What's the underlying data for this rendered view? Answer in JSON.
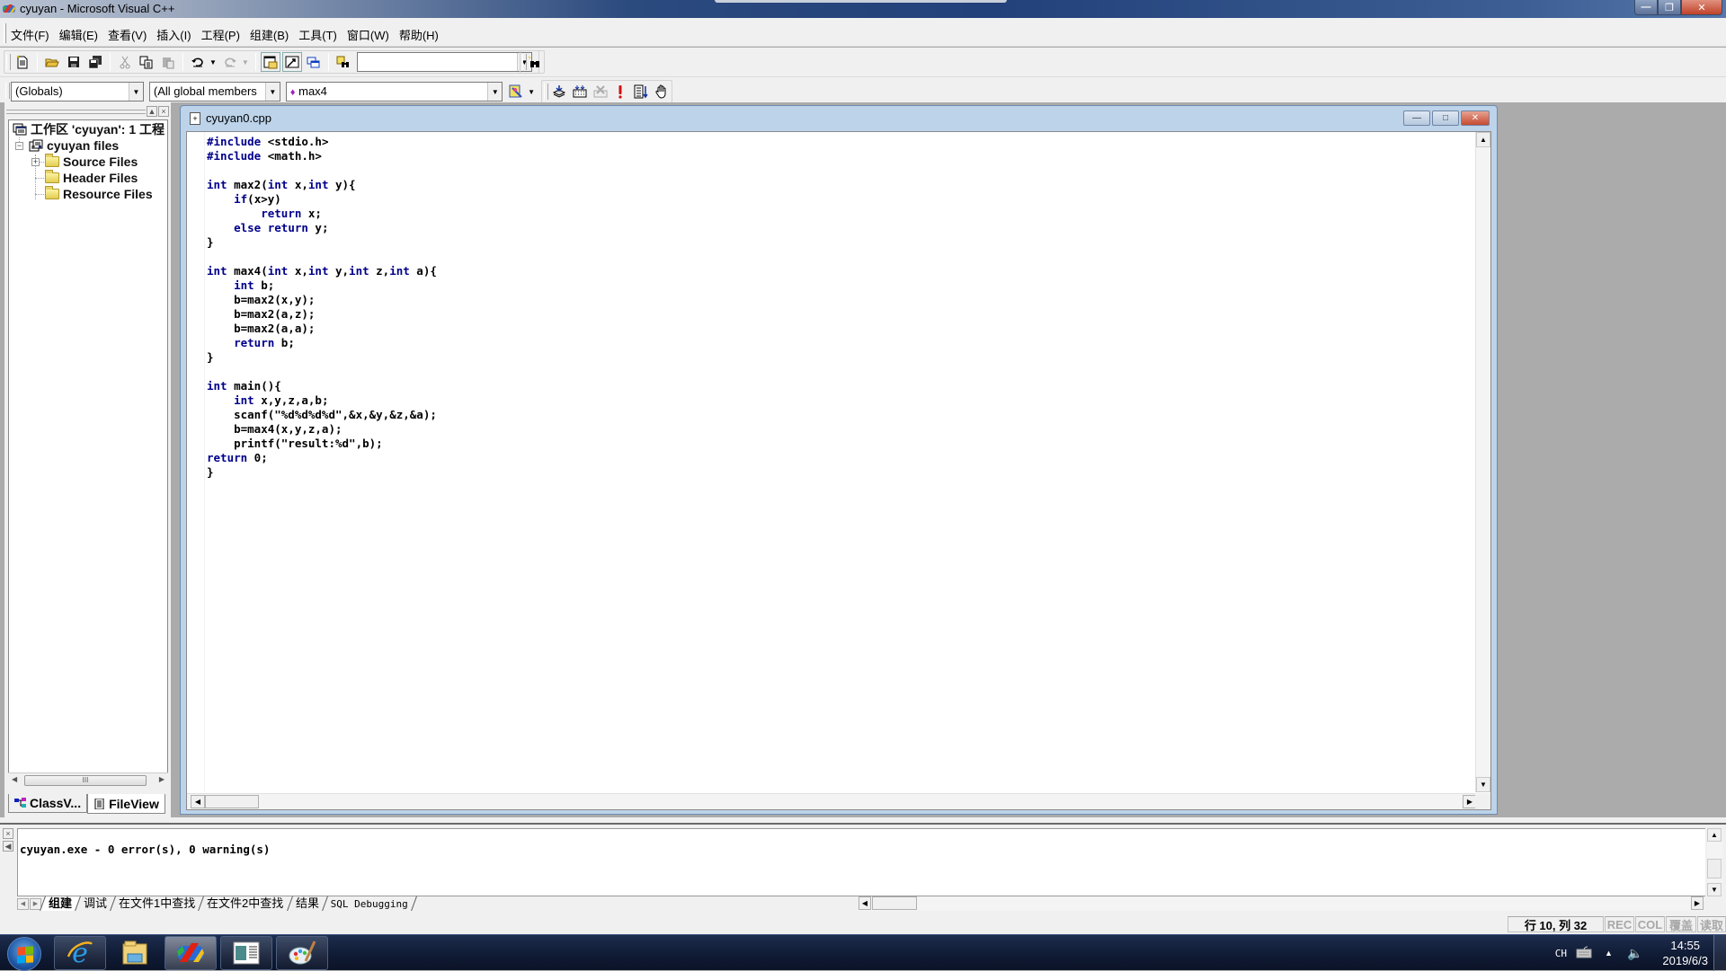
{
  "window": {
    "title": "cyuyan - Microsoft Visual C++",
    "buttons": {
      "minimize": "minimize",
      "maximize": "maximize",
      "close": "close"
    }
  },
  "menu": {
    "items": [
      {
        "label": "文件(F)"
      },
      {
        "label": "编辑(E)"
      },
      {
        "label": "查看(V)"
      },
      {
        "label": "插入(I)"
      },
      {
        "label": "工程(P)"
      },
      {
        "label": "组建(B)"
      },
      {
        "label": "工具(T)"
      },
      {
        "label": "窗口(W)"
      },
      {
        "label": "帮助(H)"
      }
    ]
  },
  "toolbar": {
    "standard_icons": [
      "new-text-file-icon",
      "open-icon",
      "save-icon",
      "save-all-icon",
      "cut-icon",
      "copy-icon",
      "paste-icon",
      "undo-icon",
      "redo-icon",
      "workspace-icon",
      "output-icon",
      "window-list-icon",
      "find-in-files-icon"
    ],
    "find_combo_value": "",
    "find_icon": "find-icon"
  },
  "wizardbar": {
    "scope": "(Globals)",
    "filter": "(All global members",
    "member": "max4",
    "member_color": "#a020c0",
    "build_icons": [
      "compile-icon",
      "build-icon",
      "stop-build-icon",
      "execute-icon",
      "go-icon",
      "breakpoint-icon"
    ]
  },
  "workspace": {
    "tree": {
      "root": "工作区 'cyuyan': 1 工程",
      "project": "cyuyan files",
      "folders": [
        "Source Files",
        "Header Files",
        "Resource Files"
      ]
    },
    "tabs": [
      {
        "label": "ClassV...",
        "active": false
      },
      {
        "label": "FileView",
        "active": true
      }
    ]
  },
  "editor": {
    "filename": "cyuyan0.cpp",
    "code_lines": [
      [
        [
          "kw",
          "#include"
        ],
        [
          "t",
          " <stdio.h>"
        ]
      ],
      [
        [
          "kw",
          "#include"
        ],
        [
          "t",
          " <math.h>"
        ]
      ],
      [],
      [
        [
          "kw",
          "int"
        ],
        [
          "t",
          " max2("
        ],
        [
          "kw",
          "int"
        ],
        [
          "t",
          " x,"
        ],
        [
          "kw",
          "int"
        ],
        [
          "t",
          " y){"
        ]
      ],
      [
        [
          "t",
          "    "
        ],
        [
          "kw",
          "if"
        ],
        [
          "t",
          "(x>y)"
        ]
      ],
      [
        [
          "t",
          "        "
        ],
        [
          "kw",
          "return"
        ],
        [
          "t",
          " x;"
        ]
      ],
      [
        [
          "t",
          "    "
        ],
        [
          "kw",
          "else"
        ],
        [
          "t",
          " "
        ],
        [
          "kw",
          "return"
        ],
        [
          "t",
          " y;"
        ]
      ],
      [
        [
          "t",
          "}"
        ]
      ],
      [],
      [
        [
          "kw",
          "int"
        ],
        [
          "t",
          " max4("
        ],
        [
          "kw",
          "int"
        ],
        [
          "t",
          " x,"
        ],
        [
          "kw",
          "int"
        ],
        [
          "t",
          " y,"
        ],
        [
          "kw",
          "int"
        ],
        [
          "t",
          " z,"
        ],
        [
          "kw",
          "int"
        ],
        [
          "t",
          " a){"
        ]
      ],
      [
        [
          "t",
          "    "
        ],
        [
          "kw",
          "int"
        ],
        [
          "t",
          " b;"
        ]
      ],
      [
        [
          "t",
          "    b=max2(x,y);"
        ]
      ],
      [
        [
          "t",
          "    b=max2(a,z);"
        ]
      ],
      [
        [
          "t",
          "    b=max2(a,a);"
        ]
      ],
      [
        [
          "t",
          "    "
        ],
        [
          "kw",
          "return"
        ],
        [
          "t",
          " b;"
        ]
      ],
      [
        [
          "t",
          "}"
        ]
      ],
      [],
      [
        [
          "kw",
          "int"
        ],
        [
          "t",
          " main(){"
        ]
      ],
      [
        [
          "t",
          "    "
        ],
        [
          "kw",
          "int"
        ],
        [
          "t",
          " x,y,z,a,b;"
        ]
      ],
      [
        [
          "t",
          "    scanf(\"%d%d%d%d\",&x,&y,&z,&a);"
        ]
      ],
      [
        [
          "t",
          "    b=max4(x,y,z,a);"
        ]
      ],
      [
        [
          "t",
          "    printf(\"result:%d\",b);"
        ]
      ],
      [
        [
          "kw",
          "return"
        ],
        [
          "t",
          " 0;"
        ]
      ],
      [
        [
          "t",
          "}"
        ]
      ]
    ]
  },
  "output": {
    "text": "cyuyan.exe - 0 error(s), 0 warning(s)",
    "tabs": [
      {
        "label": "组建",
        "active": true
      },
      {
        "label": "调试",
        "active": false
      },
      {
        "label": "在文件1中查找",
        "active": false
      },
      {
        "label": "在文件2中查找",
        "active": false
      },
      {
        "label": "结果",
        "active": false
      },
      {
        "label": "SQL Debugging",
        "active": false
      }
    ]
  },
  "statusbar": {
    "position": "行 10, 列 32",
    "indicators": [
      "REC",
      "COL",
      "覆盖",
      "读取"
    ]
  },
  "taskbar": {
    "apps": [
      {
        "name": "internet-explorer-icon",
        "active": false
      },
      {
        "name": "file-explorer-icon",
        "active": false
      },
      {
        "name": "visual-cpp-icon",
        "active": true
      },
      {
        "name": "window-app-icon",
        "active": false
      },
      {
        "name": "paint-icon",
        "active": false
      }
    ],
    "tray": {
      "language": "CH",
      "time": "14:55",
      "date": "2019/6/3"
    }
  }
}
